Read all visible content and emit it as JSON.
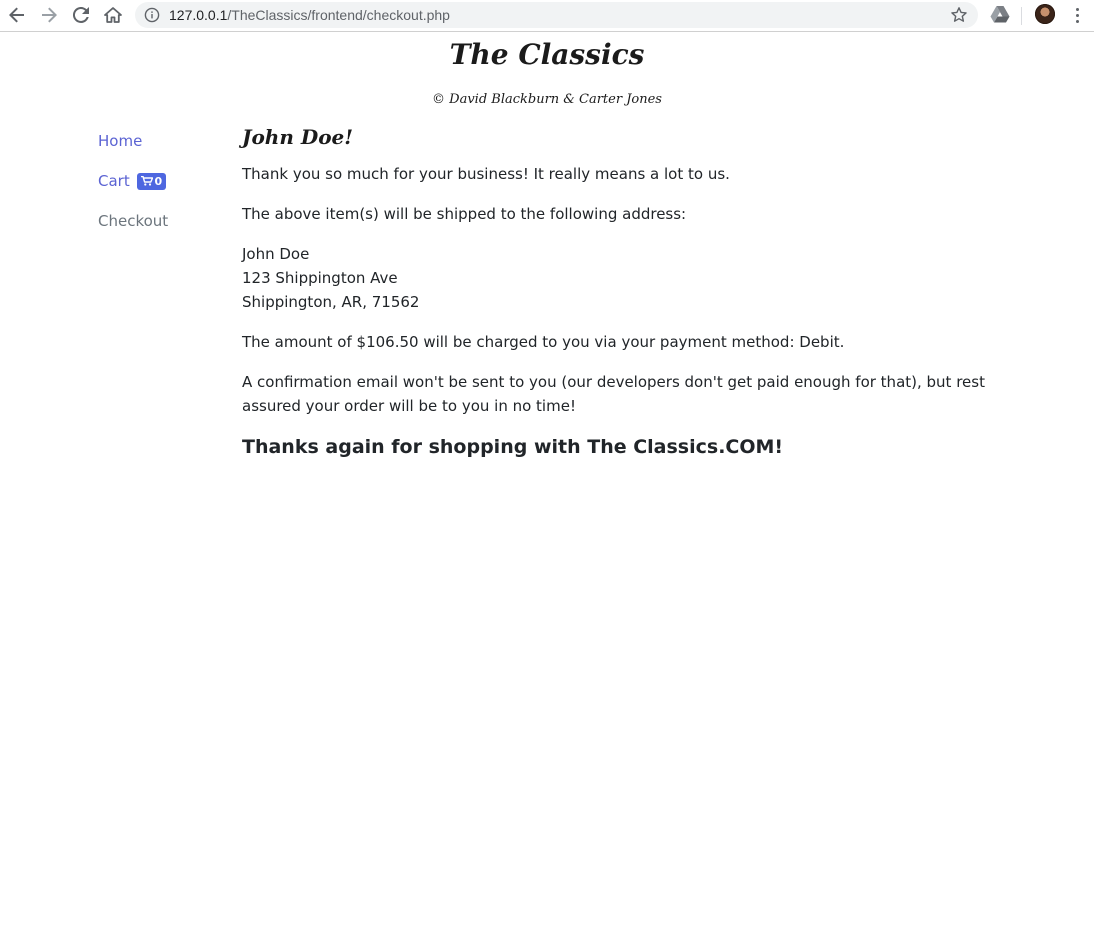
{
  "browser": {
    "url_host": "127.0.0.1",
    "url_path": "/TheClassics/frontend/checkout.php"
  },
  "site": {
    "title": "The Classics",
    "credits": "© David Blackburn & Carter Jones"
  },
  "sidebar": {
    "items": [
      {
        "label": "Home"
      },
      {
        "label": "Cart",
        "badge_count": "0"
      },
      {
        "label": "Checkout"
      }
    ]
  },
  "main": {
    "greeting": "John Doe!",
    "thank_you": "Thank you so much for your business! It really means a lot to us.",
    "shipping_intro": "The above item(s) will be shipped to the following address:",
    "address": {
      "name": "John Doe",
      "street": "123 Shippington Ave",
      "city_line": "Shippington, AR, 71562"
    },
    "charge_text": "The amount of $106.50 will be charged to you via your payment method: Debit.",
    "confirmation_text": "A confirmation email won't be sent to you (our developers don't get paid enough for that), but rest assured your order will be to you in no time!",
    "closing": "Thanks again for shopping with The Classics.COM!"
  },
  "colors": {
    "link_active": "#5b63d3",
    "link_muted": "#6c757d",
    "badge_bg": "#4e67e0",
    "text": "#212529"
  },
  "icons": {
    "back": "back-arrow-icon",
    "forward": "forward-arrow-icon",
    "reload": "reload-icon",
    "home": "home-icon",
    "info": "info-icon",
    "bookmark": "star-icon",
    "extension": "drive-icon",
    "profile": "avatar",
    "menu": "menu-dots-icon",
    "cart": "cart-icon"
  }
}
